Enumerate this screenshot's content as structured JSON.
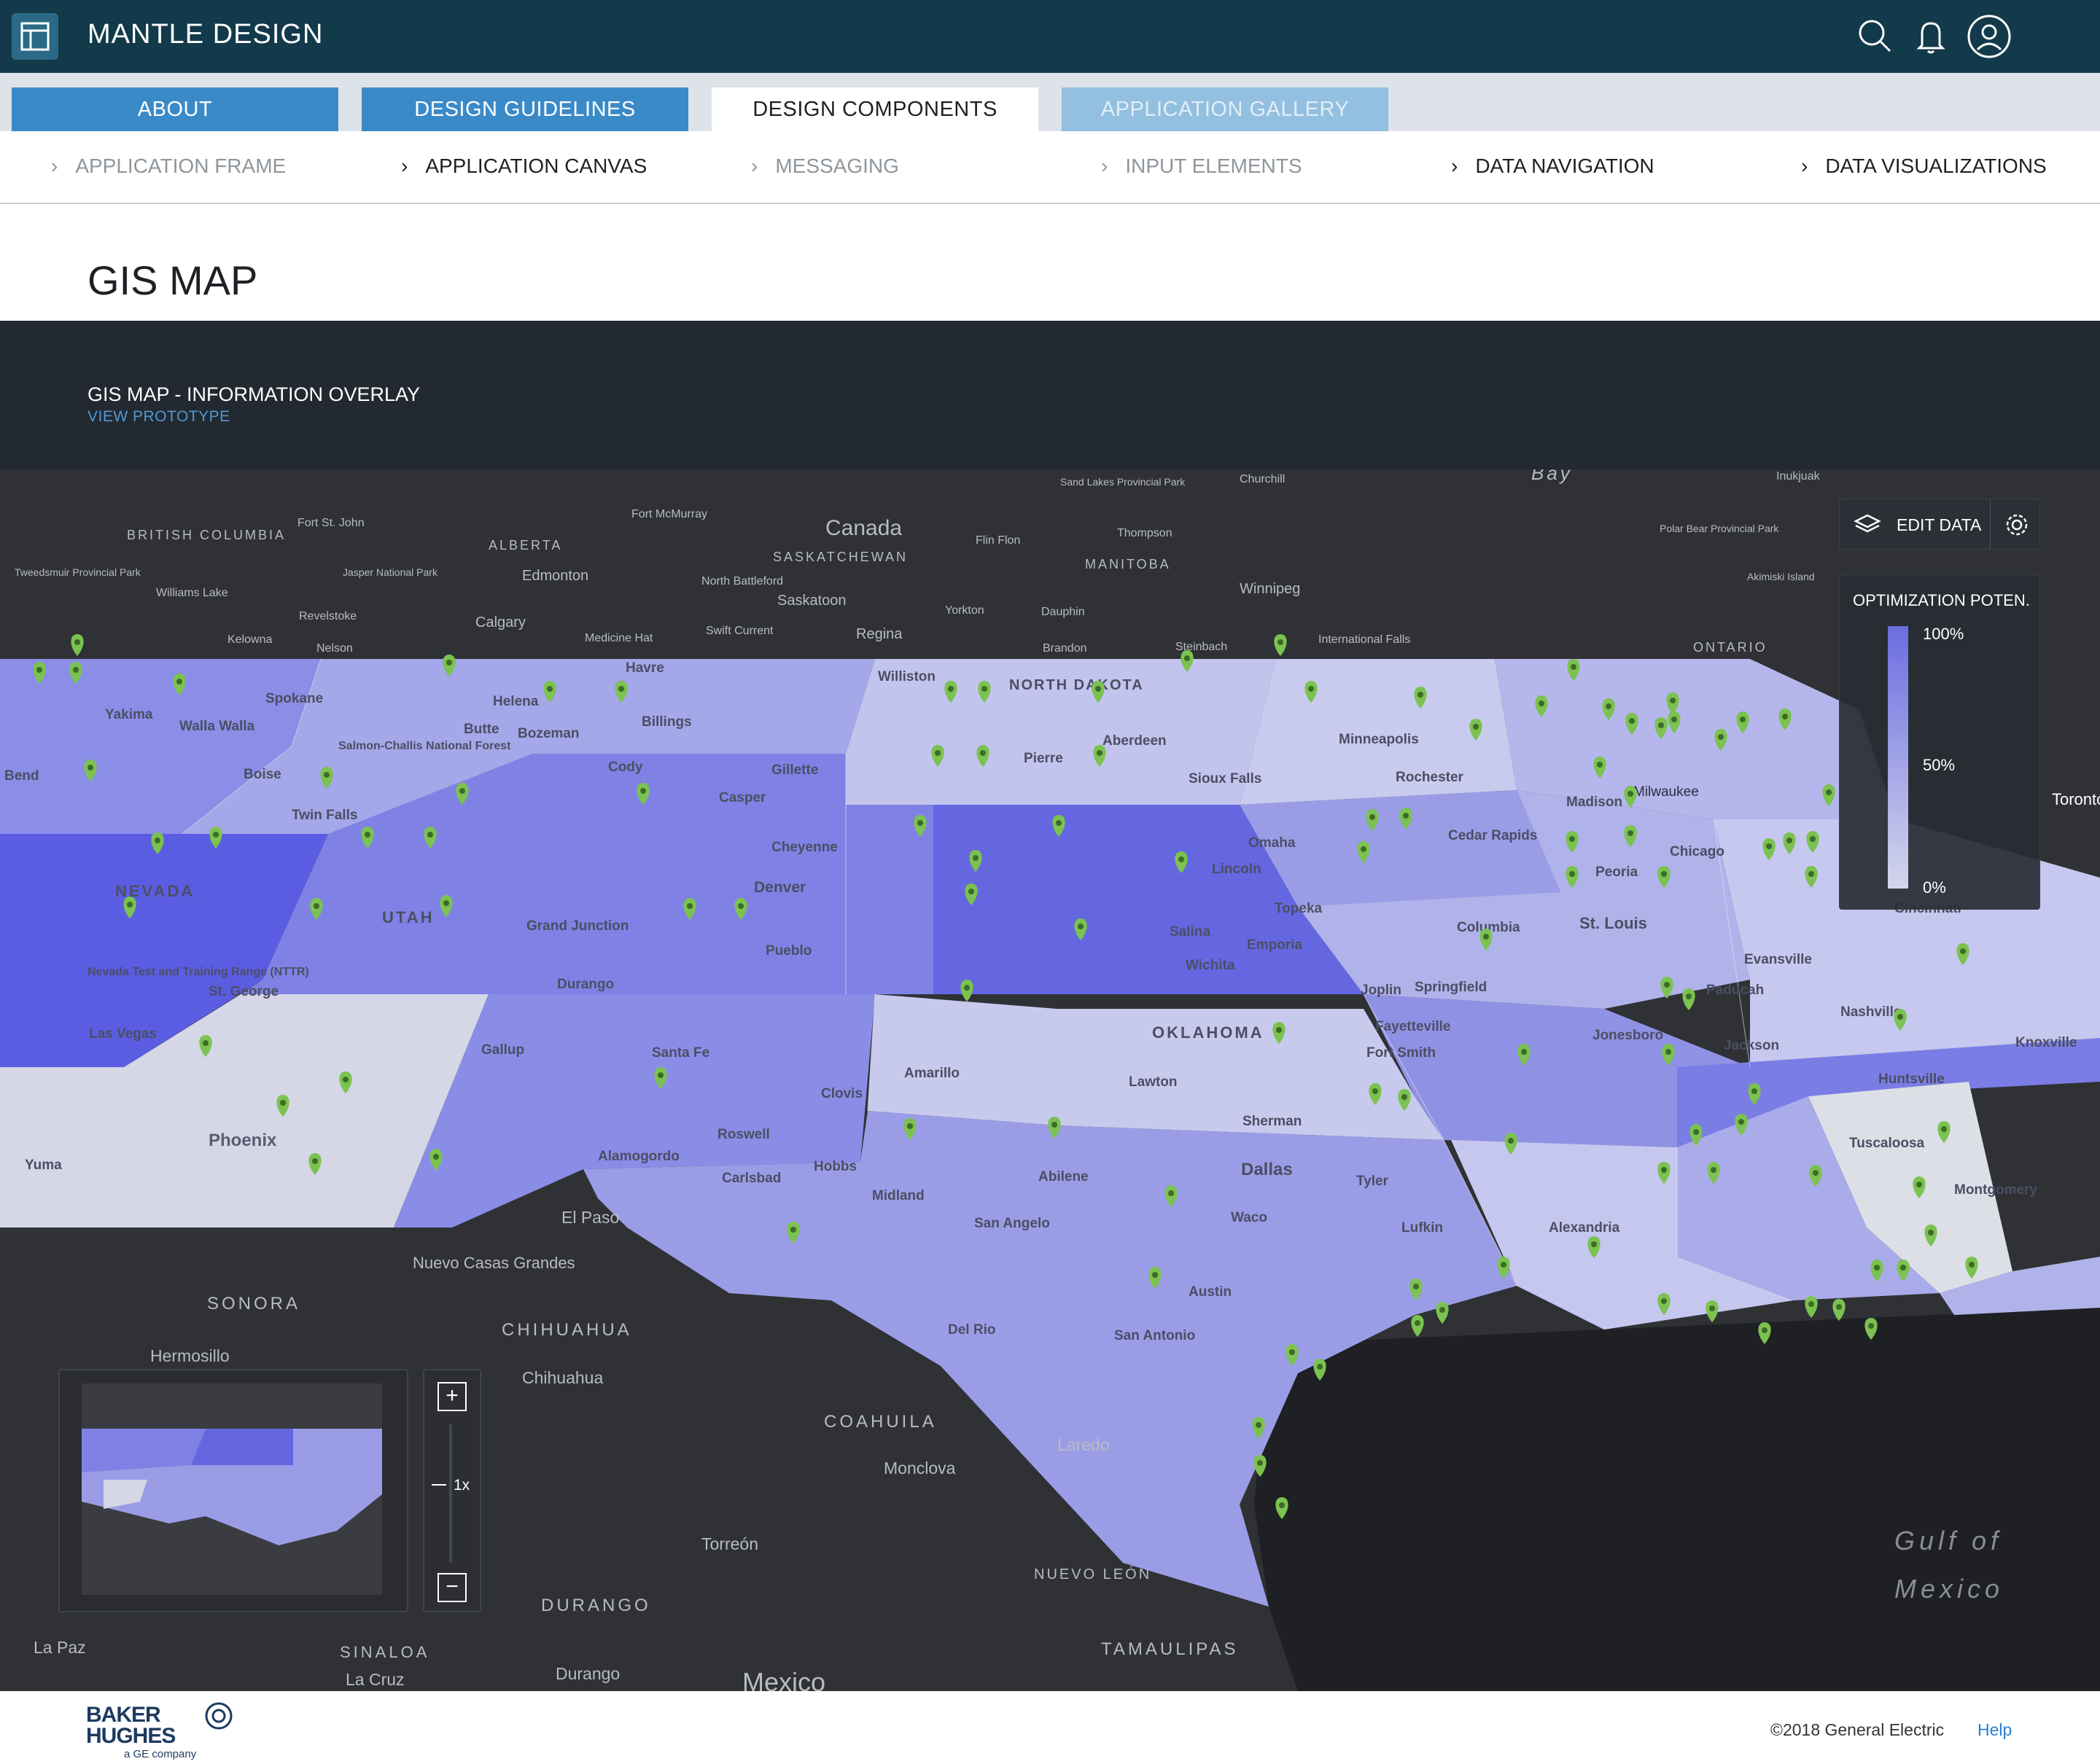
{
  "header": {
    "title": "MANTLE DESIGN",
    "icons": [
      "layout-icon",
      "search-icon",
      "bell-icon",
      "user-icon"
    ]
  },
  "tabs": [
    {
      "label": "ABOUT",
      "state": "inactive"
    },
    {
      "label": "DESIGN GUIDELINES",
      "state": "inactive"
    },
    {
      "label": "DESIGN COMPONENTS",
      "state": "active"
    },
    {
      "label": "APPLICATION GALLERY",
      "state": "disabled"
    }
  ],
  "subnav": [
    {
      "label": "APPLICATION FRAME",
      "state": "muted"
    },
    {
      "label": "APPLICATION CANVAS",
      "state": "normal"
    },
    {
      "label": "MESSAGING",
      "state": "muted"
    },
    {
      "label": "INPUT ELEMENTS",
      "state": "muted"
    },
    {
      "label": "DATA NAVIGATION",
      "state": "normal"
    },
    {
      "label": "DATA VISUALIZATIONS",
      "state": "normal"
    }
  ],
  "page": {
    "title": "GIS MAP"
  },
  "overlay": {
    "title": "GIS MAP - INFORMATION OVERLAY",
    "link": "VIEW PROTOTYPE"
  },
  "map": {
    "edit_label": "EDIT DATA",
    "legend": {
      "title": "OPTIMIZATION POTEN...",
      "ticks": [
        "100%",
        "50%",
        "0%"
      ]
    },
    "zoom": {
      "level": "1x",
      "plus": "+",
      "minus": "−"
    },
    "labels_dark": [
      "Canada",
      "ALBERTA",
      "SASKATCHEWAN",
      "MANITOBA",
      "BRITISH COLUMBIA",
      "ONTARIO",
      "Edmonton",
      "Calgary",
      "Regina",
      "Saskatoon",
      "Winnipeg",
      "Churchill",
      "Thompson",
      "Fort McMurray",
      "Fort St. John",
      "Flin Flon",
      "Yorkton",
      "Dauphin",
      "Brandon",
      "Steinbach",
      "North Battleford",
      "Swift Current",
      "Medicine Hat",
      "Kelowna",
      "Nelson",
      "Revelstoke",
      "Williams Lake",
      "Inukjuak",
      "Bay",
      "Akimiski Island",
      "Polar Bear Provincial Park",
      "Sand Lakes Provincial Park",
      "Jasper National Park",
      "Tweedsmuir Provincial Park",
      "International Falls",
      "SONORA",
      "CHIHUAHUA",
      "COAHUILA",
      "DURANGO",
      "SINALOA",
      "TAMAULIPAS",
      "NUEVO LEÓN",
      "Hermosillo",
      "Chihuahua",
      "Monclova",
      "Torreón",
      "Durango",
      "La Paz",
      "La Cruz",
      "Nuevo Casas Grandes",
      "El Paso",
      "Laredo",
      "Mexico",
      "Gulf of",
      "Mexico",
      "Toronto"
    ],
    "labels_region": [
      "NEVADA",
      "UTAH",
      "NORTH DAKOTA",
      "OKLAHOMA",
      "Yakima",
      "Walla Walla",
      "Spokane",
      "Helena",
      "Butte",
      "Bozeman",
      "Billings",
      "Havre",
      "Williston",
      "Pierre",
      "Aberdeen",
      "Sioux Falls",
      "Minneapolis",
      "Rochester",
      "Madison",
      "Milwaukee",
      "Chicago",
      "Peoria",
      "Cedar Rapids",
      "Omaha",
      "Lincoln",
      "Topeka",
      "Emporia",
      "Salina",
      "Wichita",
      "Joplin",
      "Springfield",
      "Columbia",
      "St. Louis",
      "Evansville",
      "Paducah",
      "Nashville",
      "Knoxville",
      "Jackson",
      "Jonesboro",
      "Huntsville",
      "Tuscaloosa",
      "Montgomery",
      "Fayetteville",
      "Fort Smith",
      "Lawton",
      "Sherman",
      "Dallas",
      "Tyler",
      "Waco",
      "Lufkin",
      "Alexandria",
      "Austin",
      "San Antonio",
      "Abilene",
      "San Angelo",
      "Midland",
      "Amarillo",
      "Clovis",
      "Roswell",
      "Hobbs",
      "Carlsbad",
      "Alamogordo",
      "Santa Fe",
      "Gallup",
      "Durango",
      "Pueblo",
      "Denver",
      "Cheyenne",
      "Casper",
      "Gillette",
      "Cody",
      "Grand Junction",
      "St. George",
      "Las Vegas",
      "Phoenix",
      "Yuma",
      "Boise",
      "Twin Falls",
      "Salmon-Challis National Forest",
      "Nevada Test and Training Range (NTTR)",
      "Del Rio",
      "Bend",
      "Cincinnati"
    ]
  },
  "footer": {
    "logo_line1": "BAKER",
    "logo_line2": "HUGHES",
    "logo_sub": "a GE company",
    "copyright": "©2018 General Electric",
    "help": "Help"
  },
  "colors": {
    "header_bg": "#133a4a",
    "tab_active_bg": "#ffffff",
    "tab_inactive_bg": "#3b8ac8",
    "tab_disabled_bg": "#93bfe0",
    "map_bg": "#2e3034",
    "map_fill_high": "#6b6de0",
    "map_fill_low": "#d4d6ec",
    "pin": "#7bc250",
    "link": "#4f98d6"
  }
}
